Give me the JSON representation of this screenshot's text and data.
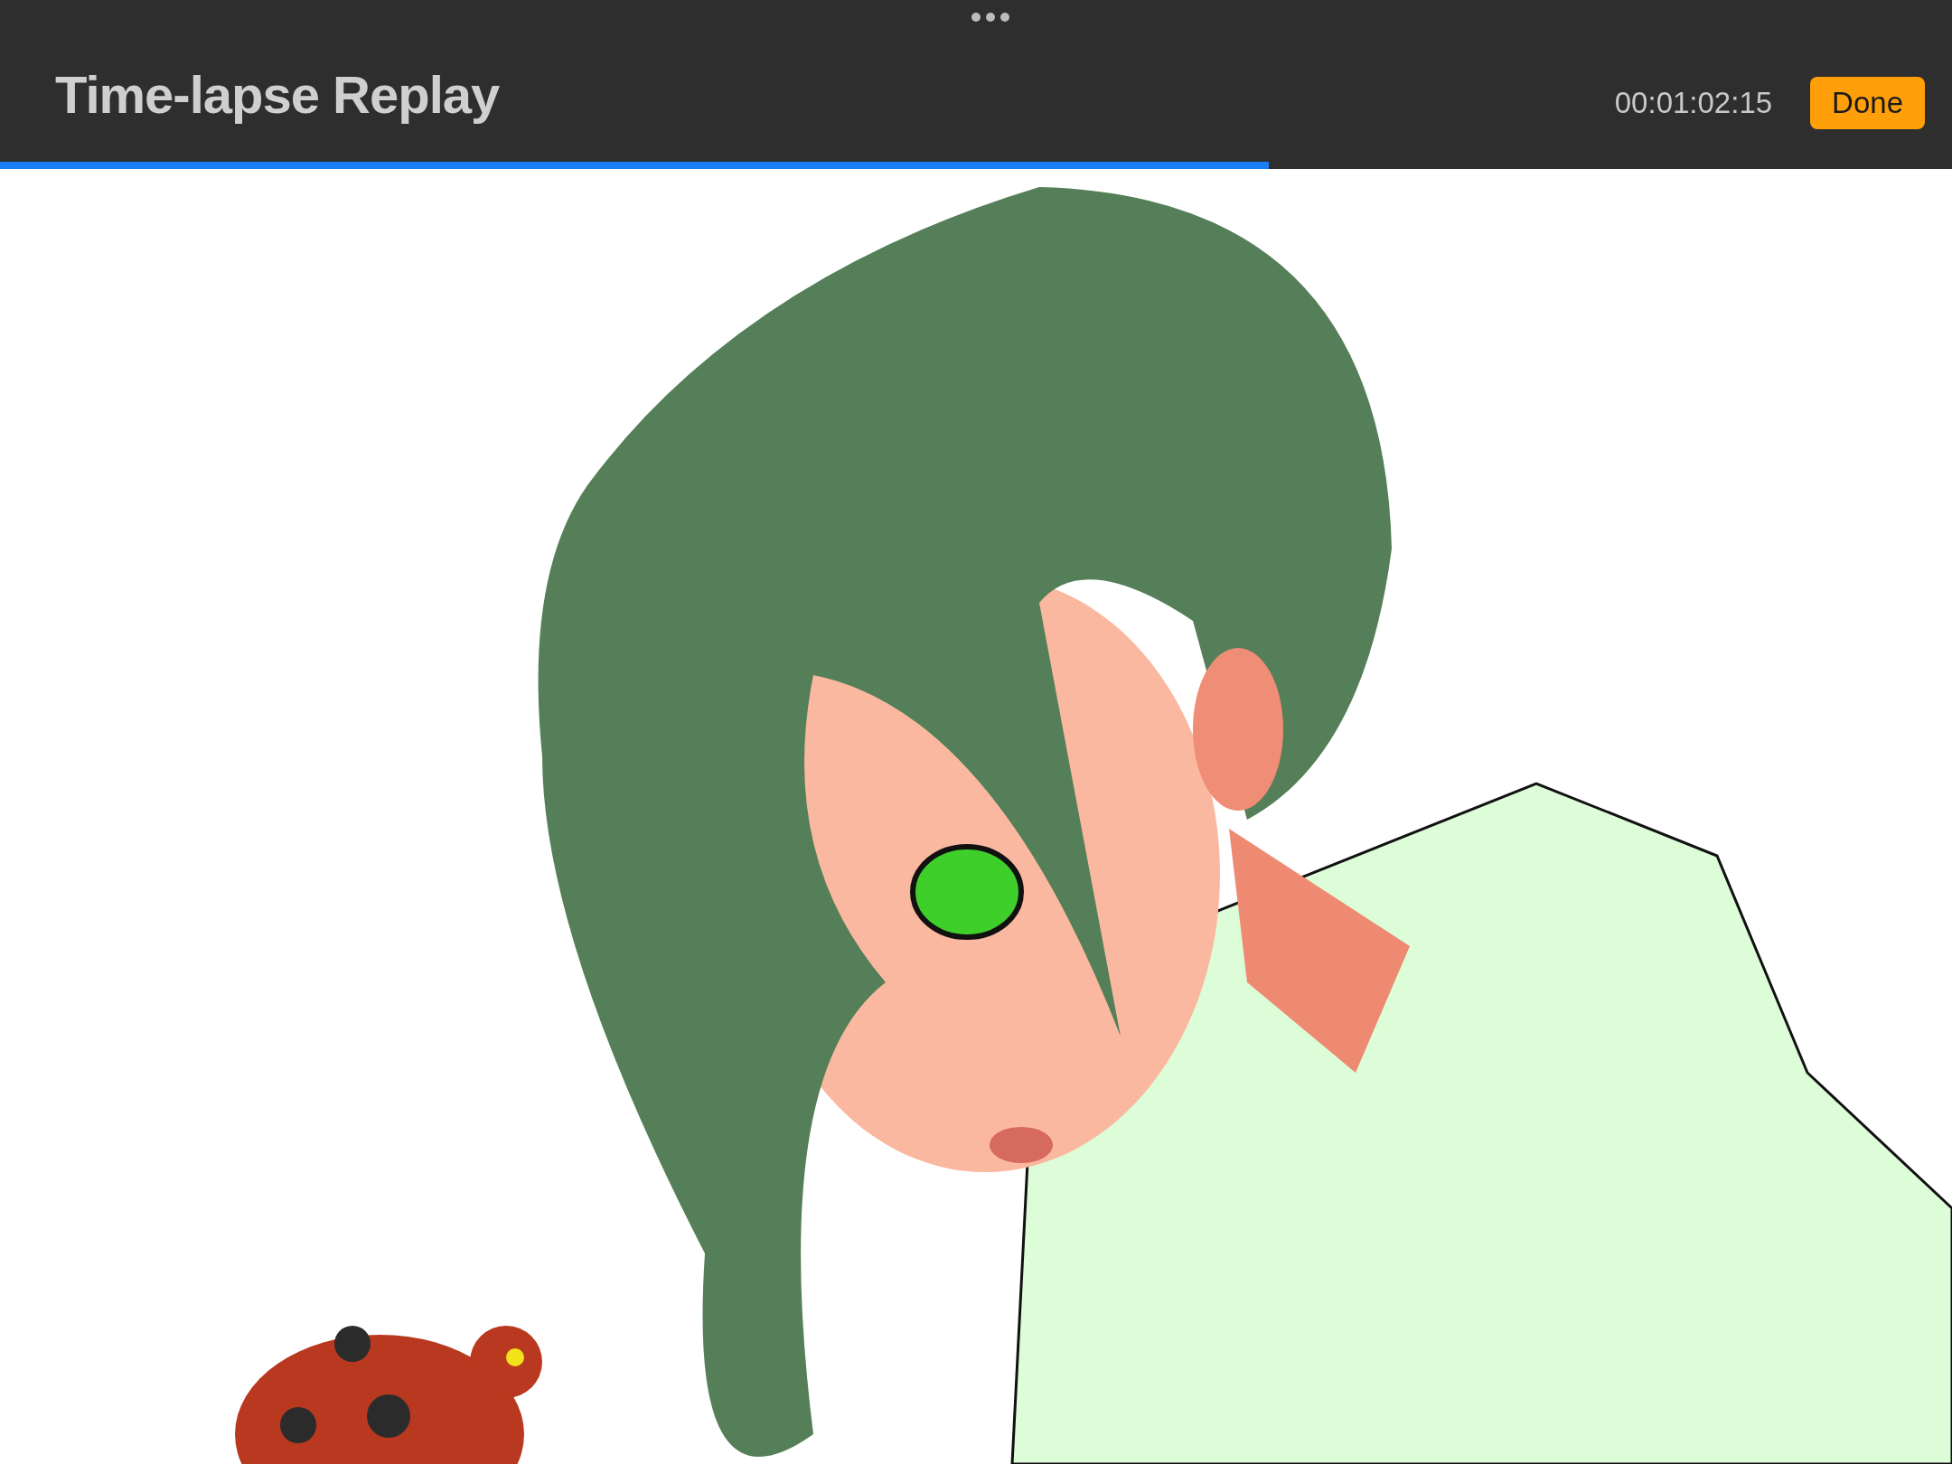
{
  "header": {
    "title": "Time-lapse Replay",
    "timecode": "00:01:02:15",
    "done_button": "Done"
  },
  "progress": {
    "level": 0.65
  }
}
